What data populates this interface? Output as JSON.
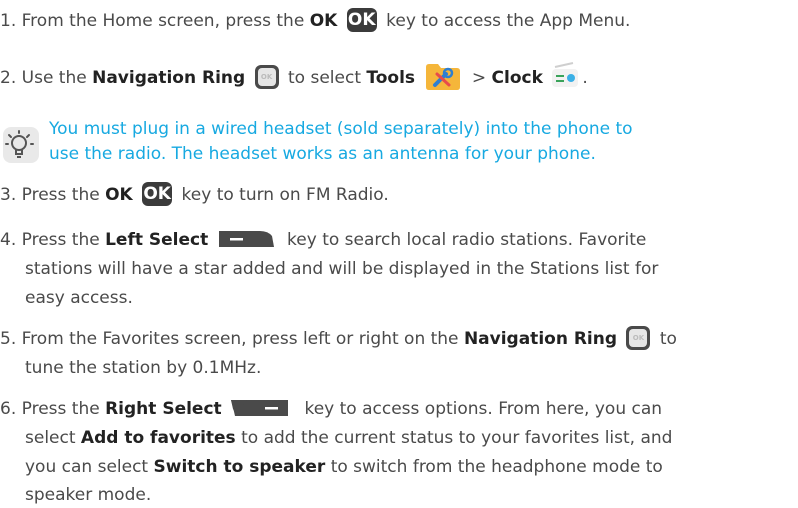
{
  "steps": [
    {
      "num": "1.",
      "pre": "From the Home screen, press the",
      "bold1": "OK",
      "key_label": "OK",
      "post": "key to access the App Menu."
    },
    {
      "num": "2.",
      "pre": "Use the",
      "bold1": "Navigation Ring",
      "nav_label": "OK",
      "mid": "to select",
      "bold2": "Tools",
      "sep": ">",
      "bold3": "Clock",
      "end": "."
    },
    {
      "num": "3.",
      "pre": "Press the",
      "bold1": "OK",
      "key_label": "OK",
      "post": "key to turn on FM Radio."
    },
    {
      "num": "4.",
      "pre": "Press the",
      "bold1": "Left Select",
      "post": "key to search local radio stations. Favorite",
      "line2": "stations will have a star added and will be displayed in the Stations list for",
      "line3": "easy access."
    },
    {
      "num": "5.",
      "pre": "From the Favorites screen, press left or right on the",
      "bold1": "Navigation Ring",
      "nav_label": "OK",
      "post": "to",
      "line2": "tune the station by 0.1MHz."
    },
    {
      "num": "6.",
      "pre": "Press the",
      "bold1": "Right Select",
      "post": "key to access options. From here, you can",
      "line2_pre": "select",
      "line2_bold": "Add to favorites",
      "line2_post": "to add the current status to your favorites list, and",
      "line3_pre": "you can select",
      "line3_bold": "Switch to speaker",
      "line3_post": "to switch from the headphone mode to",
      "line4": "speaker mode."
    }
  ],
  "note": {
    "line1": "You must plug in a wired headset (sold separately) into the phone to",
    "line2": "use the radio. The headset works as an antenna for your phone."
  },
  "colors": {
    "note": "#17a9e1",
    "key": "#3b3b3b",
    "tools": "#f5b63a"
  },
  "icons": {
    "tip": "lightbulb-icon",
    "tools": "tools-icon",
    "clock": "radio-icon",
    "left_select": "left-select-key-icon",
    "right_select": "right-select-key-icon"
  }
}
